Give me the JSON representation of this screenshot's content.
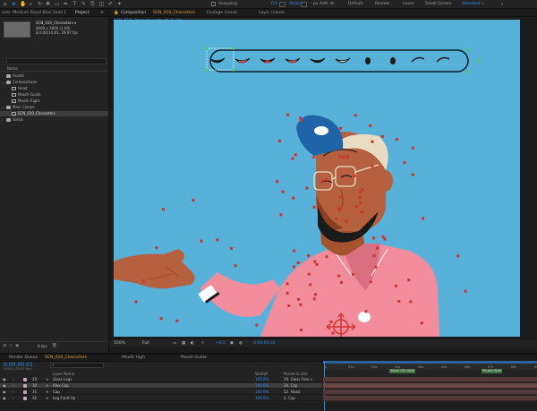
{
  "toolbar": {
    "snapping_label": "Snapping",
    "fill_label": "Fill:",
    "stroke_label": "Stroke:",
    "stroke_unit": "- px",
    "add_label": "Add:",
    "workspaces": [
      "Default",
      "Review",
      "Learn",
      "Small Screen",
      "Standard"
    ],
    "active_workspace": "Standard"
  },
  "project_panel": {
    "tab_title": "Project",
    "effect_controls_tab": "ects: Medium Royal Blue Solid 1",
    "selected_item_name": "SCN_010_Characters ▾",
    "selected_item_meta": [
      "4000 x 3000 (1.00)",
      "Δ 0;00;10;01, 29.97 fps"
    ],
    "search_placeholder": "",
    "column_name": "Name",
    "tree": [
      {
        "label": "Assets",
        "type": "folder",
        "level": 0
      },
      {
        "label": "Compositions",
        "type": "folder",
        "level": 0
      },
      {
        "label": "Head",
        "type": "comp",
        "level": 1
      },
      {
        "label": "Mouth Guide",
        "type": "comp",
        "level": 1
      },
      {
        "label": "Mouth Right",
        "type": "comp",
        "level": 1
      },
      {
        "label": "Main Comps",
        "type": "folder",
        "level": 0
      },
      {
        "label": "SCN_010_Characters",
        "type": "comp",
        "level": 1,
        "selected": true
      },
      {
        "label": "Solids",
        "type": "folder",
        "level": 0
      }
    ],
    "bpc_label": "8 bpc"
  },
  "viewer": {
    "comp_tab_prefix": "Composition",
    "comp_tab_name": "SCN_010_Characters",
    "footage_tab": "Footage (none)",
    "layer_tab": "Layer (none)",
    "breadcrumb": [
      "SCN_010_Characters",
      "Mouth Guide"
    ],
    "zoom": "100%",
    "resolution": "Full",
    "timecode": "0:00:00:01",
    "exposure": "+0.0"
  },
  "mouth_guide": {
    "shape_count": 10
  },
  "timeline": {
    "tabs": [
      "Render Queue",
      "SCN_010_Characters",
      "Mouth High",
      "Mouth Guide"
    ],
    "active_tab": "SCN_010_Characters",
    "timecode": "0:00:00:01",
    "fps_readout": "00001 (29.97 fps)",
    "search_placeholder": "",
    "headers": {
      "layer_name": "Layer Name",
      "stretch": "Stretch",
      "parent": "Parent & Link"
    },
    "layers": [
      {
        "num": "29",
        "name": "Glass Legs",
        "pct": "100.0%",
        "parent": "29. Glass Fron ∨",
        "color": "#c7a3c1"
      },
      {
        "num": "30",
        "name": "Alex Cap",
        "pct": "100.0%",
        "parent": "34. Cap",
        "color": "#c7a3c1",
        "selected": true
      },
      {
        "num": "31",
        "name": "Cap",
        "pct": "100.0%",
        "parent": "52. Head",
        "color": "#c7a3c1"
      },
      {
        "num": "32",
        "name": "Leg Front Up",
        "pct": "100.0%",
        "parent": "2. Cap",
        "color": "#c7a3c1"
      }
    ],
    "ruler_ticks": [
      "0",
      "01s",
      "02s",
      "03s",
      "04s",
      "05s",
      "06s",
      "07s",
      "08s",
      "09s"
    ],
    "markers": [
      {
        "label": "Zoom Out Start",
        "at": 0.31
      },
      {
        "label": "Phrase Start",
        "at": 0.74
      }
    ],
    "work_area_color": "#2d8ceb"
  },
  "colors": {
    "accent_blue": "#2d8ceb",
    "canvas_bg": "#58b1d9",
    "shirt_pink": "#f08c9c",
    "skin": "#b5603e",
    "cap_blue": "#1f64a6",
    "handle_red": "#d2342d"
  }
}
